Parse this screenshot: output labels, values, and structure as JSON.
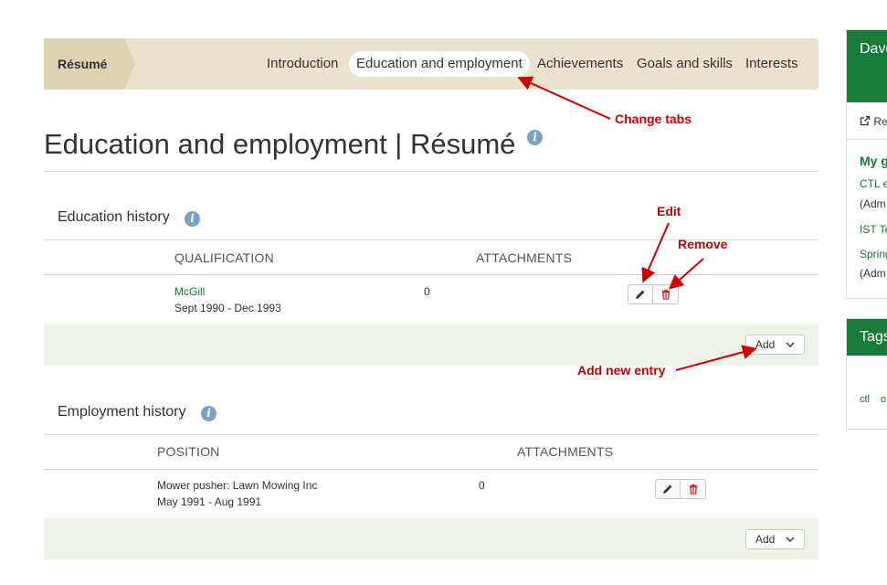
{
  "tabs": {
    "first": "Résumé",
    "items": [
      "Introduction",
      "Education and employment",
      "Achievements",
      "Goals and skills",
      "Interests"
    ],
    "active_index": 1
  },
  "page_title": "Education and employment | Résumé",
  "education": {
    "title": "Education history",
    "col_qualification": "QUALIFICATION",
    "col_attachments": "ATTACHMENTS",
    "rows": [
      {
        "name": "McGill",
        "dates": "Sept 1990 - Dec 1993",
        "attachments": "0"
      }
    ],
    "add_label": "Add"
  },
  "employment": {
    "title": "Employment history",
    "col_position": "POSITION",
    "col_attachments": "ATTACHMENTS",
    "rows": [
      {
        "name": "Mower pusher: Lawn Mowing Inc",
        "dates": "May 1991 - Aug 1991",
        "attachments": "0"
      }
    ],
    "add_label": "Add"
  },
  "annotations": {
    "change_tabs": "Change tabs",
    "edit": "Edit",
    "remove": "Remove",
    "add_new": "Add new entry"
  },
  "sidebar": {
    "profile_name": "Dave",
    "profile_link": "Re",
    "groups_title": "My g",
    "group1": "CTL e",
    "group1_role": "(Adm",
    "group2": "IST Te",
    "group3": "Spring",
    "group3_role": "(Adm",
    "tags_title": "Tags",
    "tag1": "ctl",
    "tag2": "o"
  },
  "colors": {
    "tabbar_bg": "#e9e2cd",
    "accent_green": "#1a7a3a",
    "annotation_red": "#cc0000",
    "info_blue": "#7aa1c6"
  }
}
